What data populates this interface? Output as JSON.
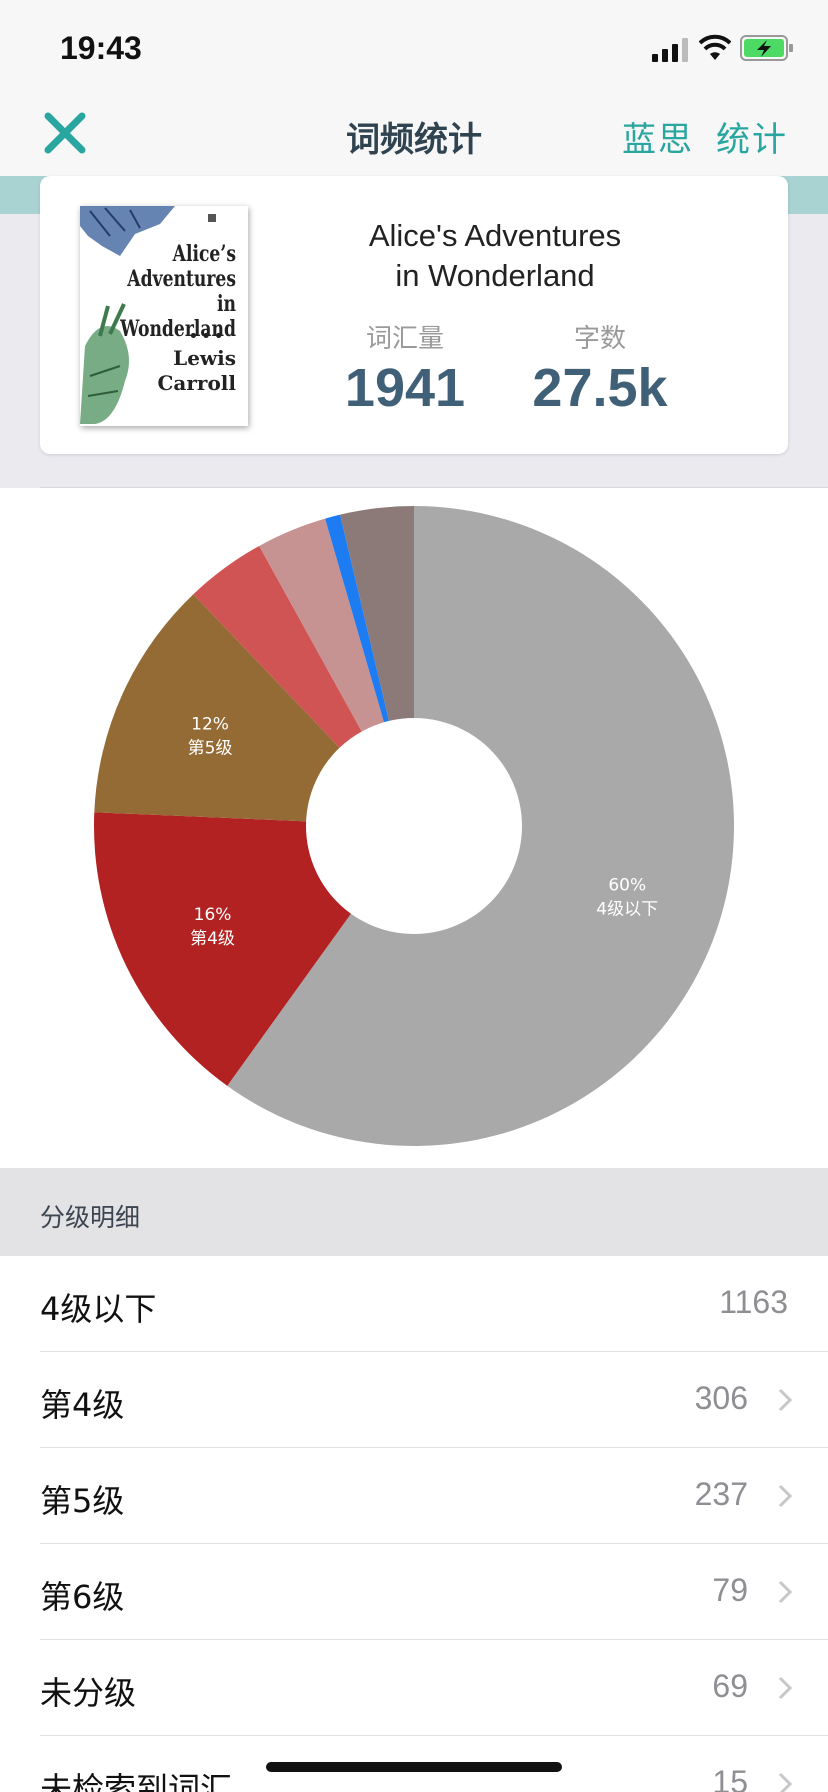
{
  "status_bar": {
    "time": "19:43"
  },
  "nav": {
    "title": "词频统计",
    "right_items": [
      "蓝思",
      "统计"
    ],
    "accent_color": "#2aa6a0"
  },
  "book": {
    "title_line1": "Alice's Adventures",
    "title_line2": "in Wonderland",
    "cover": {
      "title_lines": [
        "Alice’s",
        "Adventures in",
        "Wonderland"
      ],
      "dots": "•••",
      "author_lines": [
        "Lewis",
        "Carroll"
      ]
    },
    "stats": {
      "vocab_label": "词汇量",
      "vocab_value": "1941",
      "words_label": "字数",
      "words_value": "27.5k"
    }
  },
  "chart_data": {
    "type": "pie",
    "donut": true,
    "series": [
      {
        "name": "4级以下",
        "value": 1163,
        "percent_label": "60%",
        "color": "#a9a9a9"
      },
      {
        "name": "第4级",
        "value": 306,
        "percent_label": "16%",
        "color": "#b22222"
      },
      {
        "name": "第5级",
        "value": 237,
        "percent_label": "12%",
        "color": "#946b35"
      },
      {
        "name": "第6级",
        "value": 79,
        "percent_label": "",
        "color": "#d05454"
      },
      {
        "name": "未分级",
        "value": 69,
        "percent_label": "",
        "color": "#c79292"
      },
      {
        "name": "未检索到词汇",
        "value": 15,
        "percent_label": "",
        "color": "#1d7cf2"
      },
      {
        "name": "",
        "value": 72,
        "percent_label": "",
        "color": "#8b7a77"
      }
    ],
    "start_angle": "top",
    "direction": "clockwise"
  },
  "section": {
    "title": "分级明细"
  },
  "levels": [
    {
      "label": "4级以下",
      "count": "1163",
      "has_chevron": false
    },
    {
      "label": "第4级",
      "count": "306",
      "has_chevron": true
    },
    {
      "label": "第5级",
      "count": "237",
      "has_chevron": true
    },
    {
      "label": "第6级",
      "count": "79",
      "has_chevron": true
    },
    {
      "label": "未分级",
      "count": "69",
      "has_chevron": true
    },
    {
      "label": "未检索到词汇",
      "count": "15",
      "has_chevron": true
    }
  ]
}
